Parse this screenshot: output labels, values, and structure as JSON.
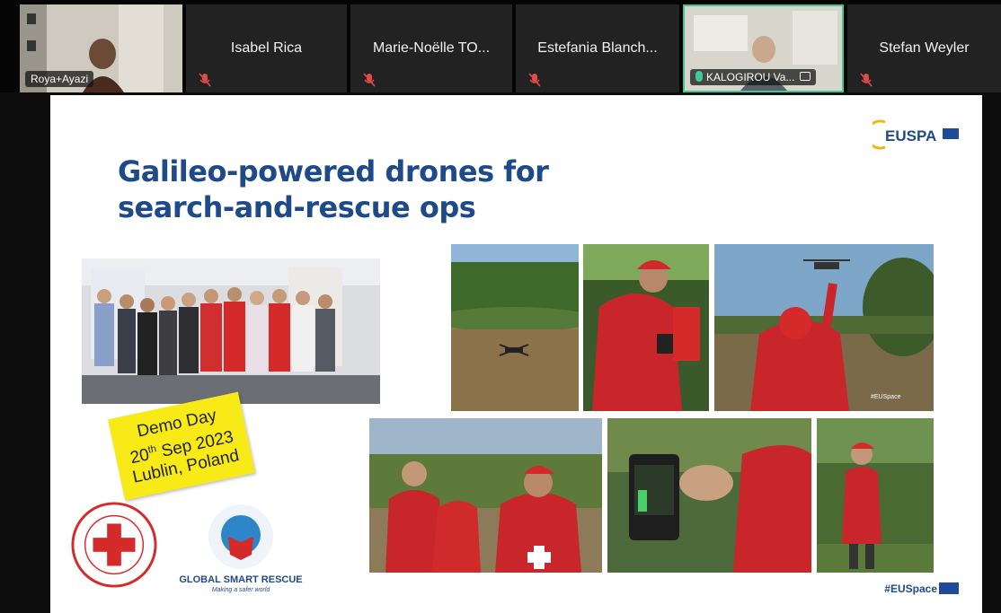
{
  "participants": [
    {
      "name": "Roya+Ayazi",
      "video": true,
      "muted": false,
      "active": false
    },
    {
      "name": "Isabel Rica",
      "video": false,
      "muted": true,
      "active": false
    },
    {
      "name": "Marie-Noëlle TO...",
      "video": false,
      "muted": true,
      "active": false
    },
    {
      "name": "Estefania Blanch...",
      "video": false,
      "muted": true,
      "active": false
    },
    {
      "name": "KALOGIROU Va...",
      "video": true,
      "muted": false,
      "active": true
    },
    {
      "name": "Stefan Weyler",
      "video": false,
      "muted": true,
      "active": false
    }
  ],
  "slide": {
    "title_line1": "Galileo-powered drones for",
    "title_line2": "search-and-rescue ops",
    "logo_text": "EUSPA",
    "sticky_line1": "Demo Day",
    "sticky_line2_pre": "20",
    "sticky_line2_sup": "th",
    "sticky_line2_post": " Sep 2023",
    "sticky_line3": "Lublin, Poland",
    "gsr_name": "GLOBAL SMART RESCUE",
    "gsr_tagline": "Making a safer world",
    "footer_brand": "#EUSpace",
    "photo_watermark": "#EUSpace"
  },
  "colors": {
    "title": "#1e4a8a",
    "sticky": "#f8ea17",
    "red": "#d42a2a",
    "active_border": "#3fc99a"
  }
}
